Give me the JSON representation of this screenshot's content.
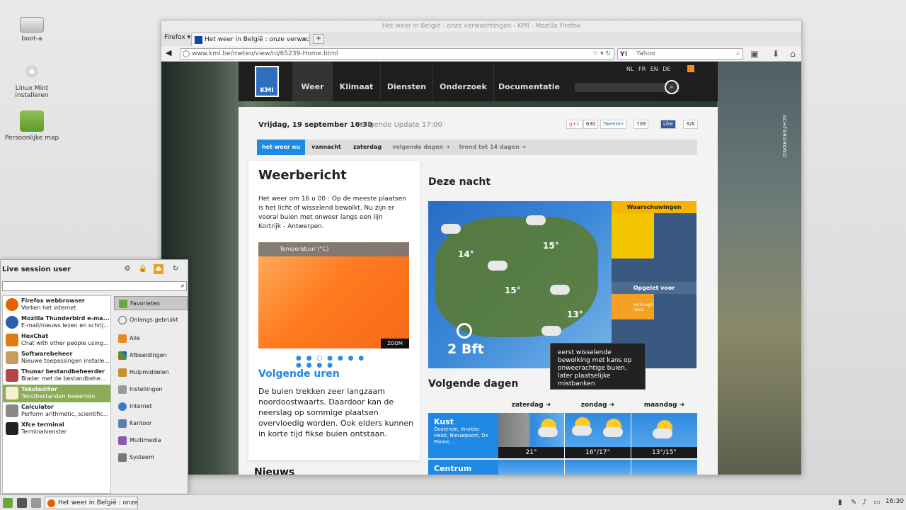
{
  "desktop": {
    "icons": [
      {
        "label": "boot-a"
      },
      {
        "label": "Linux Mint installeren"
      },
      {
        "label": "Persoonlijke map"
      }
    ]
  },
  "window": {
    "title": "Het weer in België : onze verwachtingen - KMI - Mozilla Firefox",
    "firefox_menu": "Firefox ▾",
    "tab_label": "Het weer in België : onze verwach...",
    "tab_close": "×",
    "new_tab": "+",
    "url": "www.kmi.be/meteo/view/nl/65239-Home.html",
    "search_engine": "Y!",
    "search_placeholder": "Yahoo"
  },
  "kmi": {
    "logo": "KMI",
    "nav": [
      "Weer",
      "Klimaat",
      "Diensten",
      "Onderzoek",
      "Documentatie"
    ],
    "langs": "NL FR EN DE",
    "background_label": "ACHTERGROND",
    "date": "Vrijdag, 19 september 16:30",
    "next_update": "Volgende Update 17:00",
    "social": {
      "gplus": "g+1",
      "gplus_count": "630",
      "tweet": "Tweeten",
      "tweet_count": "709",
      "like": "Like",
      "like_count": "32k"
    },
    "subnav": [
      "het weer nu",
      "vannacht",
      "zaterdag",
      "volgende dagen ➜",
      "trend tot 14 dagen ➜"
    ],
    "weerbericht": {
      "title": "Weerbericht",
      "text": "Het weer om 16 u 00 : Op de meeste plaatsen is het licht of wisselend bewolkt. Nu zijn er vooral buien met onweer langs een lijn Kortrijk - Antwerpen."
    },
    "temp_map": {
      "header": "Temperatuur (°C)",
      "zoom": "ZOOM"
    },
    "carousel_dots": "● ● ○ ● ● ● ● ● ● ● ●",
    "volgende_uren": {
      "title": "Volgende uren",
      "text": "De buien trekken zeer langzaam noordoostwaarts. Daardoor kan de neerslag op sommige plaatsen overvloedig worden. Ook elders kunnen in korte tijd fikse buien ontstaan."
    },
    "nieuws": "Nieuws",
    "deze_nacht": {
      "title": "Deze nacht",
      "temps": [
        "14°",
        "15°",
        "15°",
        "13°"
      ],
      "wind": "2 Bft",
      "warnings": "Waarschuwingen",
      "opgelet": "Opgelet voor",
      "verhoogd": "verhoogd risico"
    },
    "tooltip": "eerst wisselende bewolking met kans op onweerachtige buien, later plaatselijke mistbanken",
    "volgende_dagen": {
      "title": "Volgende dagen",
      "days": [
        "zaterdag ➜",
        "zondag ➜",
        "maandag ➜"
      ],
      "regions": [
        {
          "name": "Kust",
          "places": "Oostende, Knokke-Heist, Nieuwpoort, De Panne, ...",
          "temps": [
            "21°",
            "16°/17°",
            "13°/15°"
          ]
        },
        {
          "name": "Centrum"
        }
      ]
    }
  },
  "menu": {
    "header": "Live session user",
    "apps": [
      {
        "name": "Firefox webbrowser",
        "desc": "Verken het internet"
      },
      {
        "name": "Mozilla Thunderbird e-ma...",
        "desc": "E-mail/nieuws lezen en schrij..."
      },
      {
        "name": "HexChat",
        "desc": "Chat with other people using..."
      },
      {
        "name": "Softwarebeheer",
        "desc": "Nieuwe toepassingen installe..."
      },
      {
        "name": "Thunar bestandbeheerder",
        "desc": "Blader met de bestandbehe..."
      },
      {
        "name": "Teksteditor",
        "desc": "Tekstbestanden bewerken"
      },
      {
        "name": "Calculator",
        "desc": "Perform arithmetic, scientific..."
      },
      {
        "name": "Xfce terminal",
        "desc": "Terminalvenster"
      }
    ],
    "categories": [
      "Favorieten",
      "Onlangs gebruikt",
      "Alle",
      "Afbeeldingen",
      "Hulpmiddelen",
      "Instellingen",
      "Internet",
      "Kantoor",
      "Multimedia",
      "Systeem"
    ]
  },
  "taskbar": {
    "task": "Het weer in België : onze ...",
    "clock": "16:30"
  }
}
